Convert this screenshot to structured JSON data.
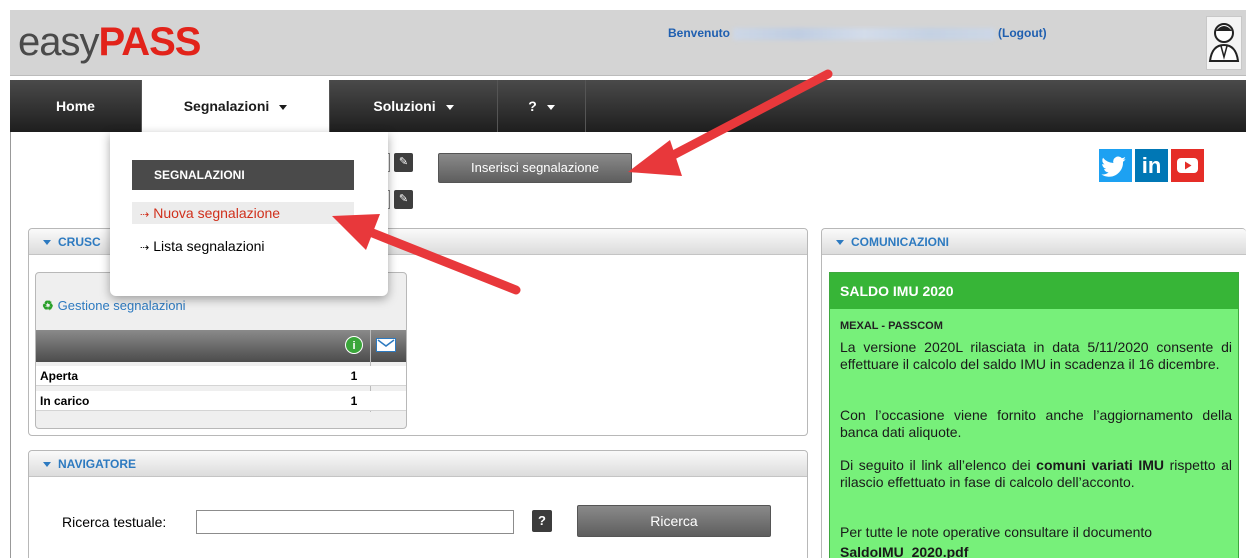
{
  "header": {
    "logo_prefix": "easy",
    "logo_suffix": "PASS",
    "welcome": "Benvenuto",
    "logout": "(Logout)"
  },
  "nav": {
    "home": "Home",
    "segnalazioni": "Segnalazioni",
    "soluzioni": "Soluzioni",
    "help": "?"
  },
  "dropdown": {
    "title": "SEGNALAZIONI",
    "items": [
      "Nuova segnalazione",
      "Lista segnalazioni"
    ]
  },
  "toolbar": {
    "insert_button": "Inserisci segnalazione"
  },
  "social": {
    "twitter": "twitter-icon",
    "linkedin": "in",
    "youtube": "youtube-icon"
  },
  "cruscotto": {
    "title": "CRUSC",
    "gestione": "Gestione segnalazioni",
    "rows": [
      {
        "label": "Aperta",
        "count": "1"
      },
      {
        "label": "In carico",
        "count": "1"
      }
    ]
  },
  "comunicazioni": {
    "title": "COMUNICAZIONI",
    "news_title": "SALDO IMU 2020",
    "news_sub": "MEXAL - PASSCOM",
    "p1": "La versione 2020L rilasciata in data 5/11/2020 consente di effettuare il calcolo del saldo IMU in scadenza il 16 dicembre.",
    "p2": "Con l’occasione viene fornito anche l’aggiornamento della banca dati aliquote.",
    "p3_a": "Di seguito il link all’elenco dei ",
    "p3_b": "comuni variati IMU",
    "p3_c": " rispetto al rilascio effettuato in fase di calcolo dell’acconto.",
    "p4": "Per tutte le note operative consultare il documento",
    "p4_file": "SaldoIMU_2020.pdf"
  },
  "navigatore": {
    "title": "NAVIGATORE",
    "search_label": "Ricerca testuale:",
    "help": "?",
    "search_button": "Ricerca"
  },
  "colors": {
    "brand_red": "#e2231a",
    "nav_dark": "#2a2a2a",
    "link_blue": "#2d7ac0",
    "news_green": "#77f07a",
    "arrow_red": "#e8383b"
  }
}
